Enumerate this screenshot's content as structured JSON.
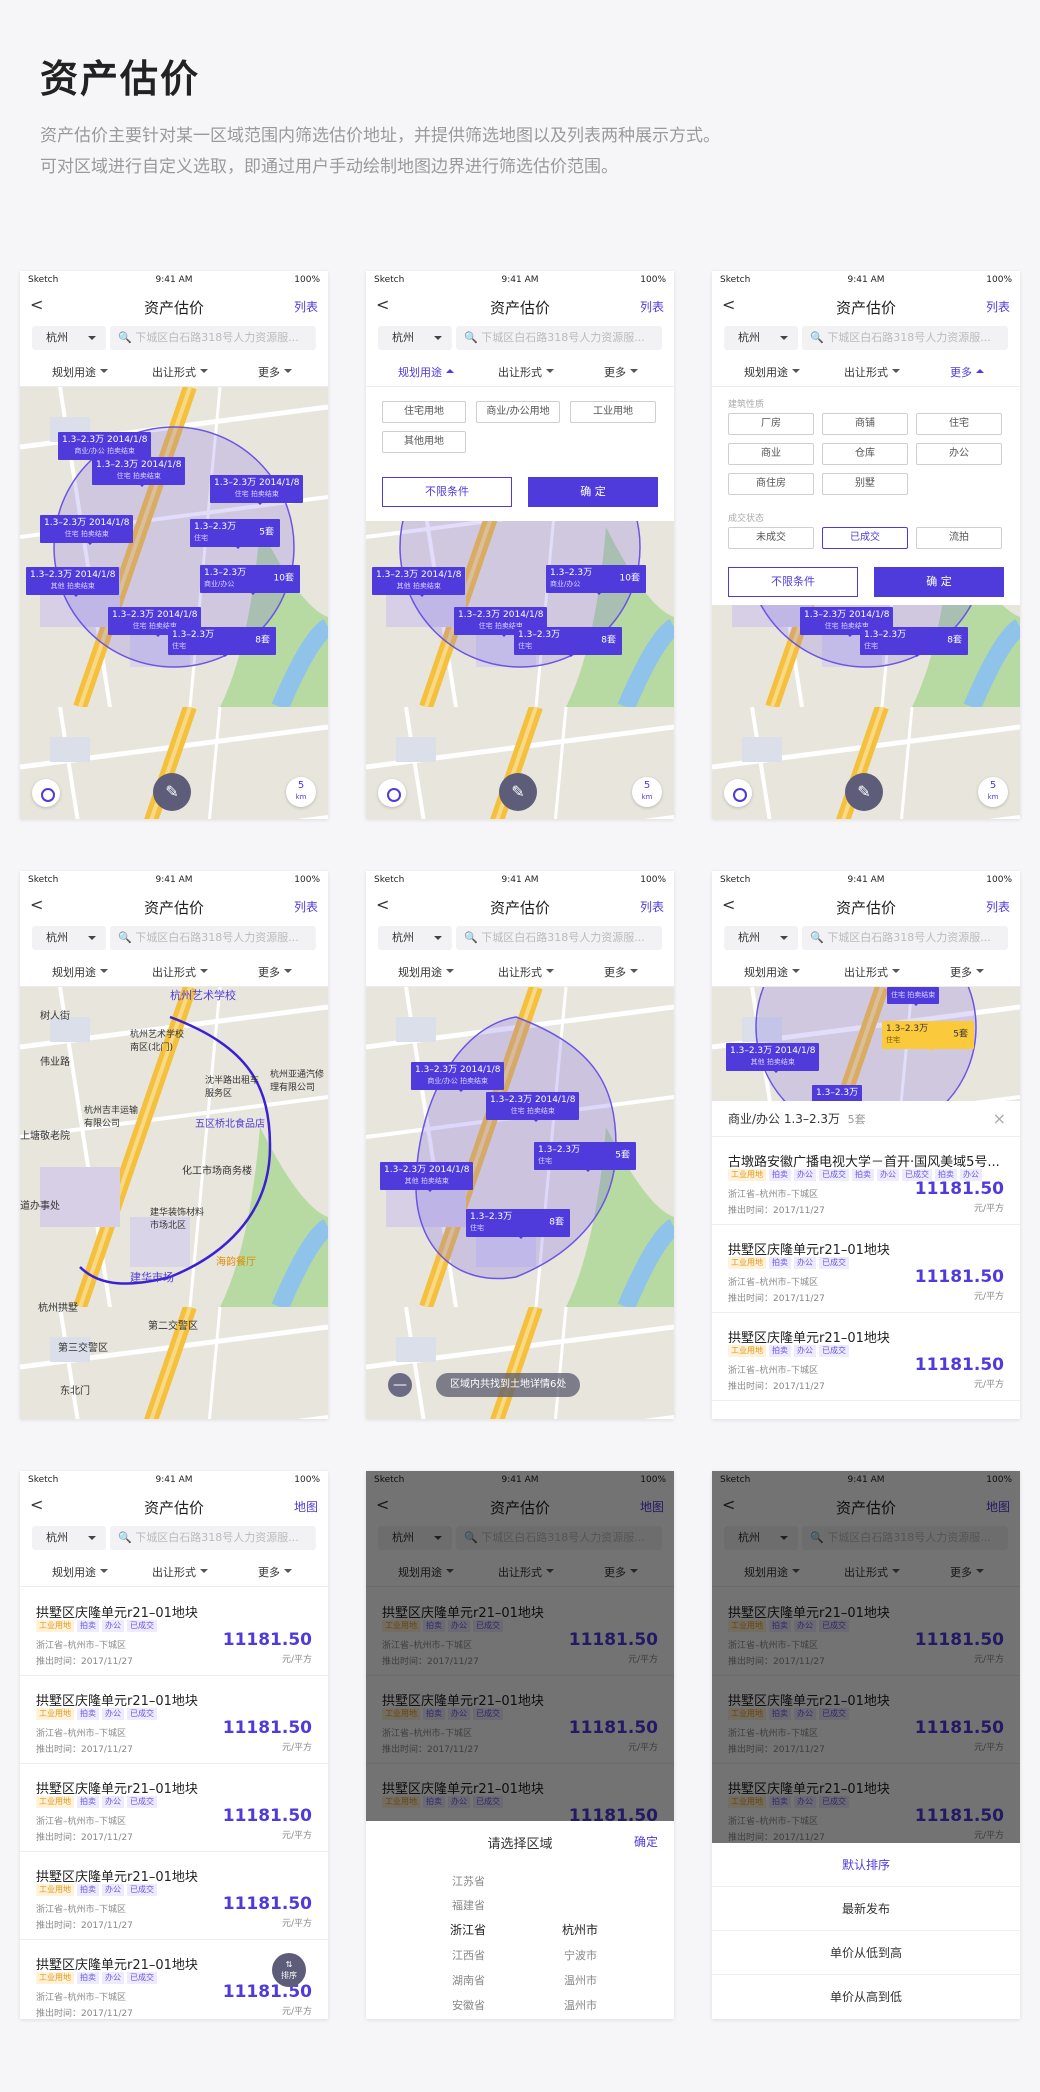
{
  "header": {
    "title": "资产估价",
    "desc_line1": "资产估价主要针对某一区域范围内筛选估价地址，并提供筛选地图以及列表两种展示方式。",
    "desc_line2": "可对区域进行自定义选取，即通过用户手动绘制地图边界进行筛选估价范围。"
  },
  "status": {
    "carrier": "Sketch",
    "time": "9:41 AM",
    "battery": "100%"
  },
  "nav": {
    "title": "资产估价",
    "back": "<",
    "list": "列表",
    "map": "地图"
  },
  "search": {
    "city": "杭州",
    "placeholder": "下城区白石路318号人力资源服..."
  },
  "filters": {
    "use": "规划用途",
    "form": "出让形式",
    "more": "更多"
  },
  "map_tags": [
    {
      "price": "1.3–2.3万",
      "date": "2014/1/8",
      "t1": "商业/办公",
      "t2": "拍卖结束"
    },
    {
      "price": "1.3–2.3万",
      "date": "2014/1/8",
      "t1": "住宅",
      "t2": "拍卖结束"
    },
    {
      "price": "1.3–2.3万",
      "count": "5套",
      "t1": "住宅"
    },
    {
      "price": "1.3–2.3万",
      "date": "2014/1/8",
      "t1": "其他",
      "t2": "拍卖结束"
    },
    {
      "price": "1.3–2.3万",
      "count": "10套",
      "t1": "商业/办公"
    },
    {
      "price": "1.3–2.3万",
      "count": "8套",
      "t1": "住宅"
    }
  ],
  "map_labels": {
    "km": "5",
    "km_unit": "km",
    "pen": "✎"
  },
  "use_options": [
    "住宅用地",
    "商业/办公用地",
    "工业用地",
    "其他用地"
  ],
  "buttons": {
    "reset": "不限条件",
    "confirm": "确 定"
  },
  "more_panel": {
    "type_label": "建筑性质",
    "types": [
      "厂房",
      "商铺",
      "住宅",
      "商业",
      "仓库",
      "办公",
      "商住房",
      "别墅"
    ],
    "state_label": "成交状态",
    "states": [
      "未成交",
      "已成交",
      "流拍"
    ]
  },
  "draw_map": {
    "labels": [
      "杭州艺术学校",
      "杭州艺术学校南区(北门)",
      "沈半路出租车服务区",
      "杭州亚通汽修理有限公司",
      "杭州吉丰运输有限公司",
      "五区桥北食品店",
      "化工市场商务楼",
      "建华装饰材料市场北区",
      "海韵餐厅",
      "建华市场",
      "杭州拱墅",
      "第二交警区",
      "第三交警区",
      "树人街",
      "伟业路",
      "上塘敬老院",
      "道办事处",
      "东北门"
    ]
  },
  "region_bar": {
    "zero": "—",
    "text": "区域内共找到土地详情6处"
  },
  "info": {
    "title": "商业/办公 1.3–2.3万",
    "count": "5套",
    "close": "×"
  },
  "listings": [
    {
      "name": "古墩路安徽广播电视大学－首开·国风美域5号...",
      "tags": [
        "工业用地",
        "拍卖",
        "办公",
        "已成交",
        "拍卖",
        "办公",
        "已成交",
        "拍卖",
        "办公"
      ],
      "addr": "浙江省–杭州市–下城区",
      "date": "推出时间：2017/11/27",
      "price": "11181.50",
      "unit": "元/平方"
    },
    {
      "name": "拱墅区庆隆单元r21–01地块",
      "tags": [
        "工业用地",
        "拍卖",
        "办公",
        "已成交"
      ],
      "addr": "浙江省–杭州市–下城区",
      "date": "推出时间：2017/11/27",
      "price": "11181.50",
      "unit": "元/平方"
    }
  ],
  "region_sheet": {
    "title": "请选择区域",
    "confirm": "确定",
    "provinces": [
      "江苏省",
      "福建省",
      "浙江省",
      "江西省",
      "湖南省",
      "安徽省"
    ],
    "cities": [
      "杭州市",
      "宁波市",
      "温州市",
      "温州市"
    ]
  },
  "sort_sheet": {
    "options": [
      "默认排序",
      "最新发布",
      "单价从低到高",
      "单价从高到低"
    ]
  },
  "sort_fab": {
    "icon": "⇅",
    "label": "排序"
  },
  "colors": {
    "accent": "#4f3bdc",
    "yellow": "#fbc93c",
    "map": "#e9e6dd"
  }
}
